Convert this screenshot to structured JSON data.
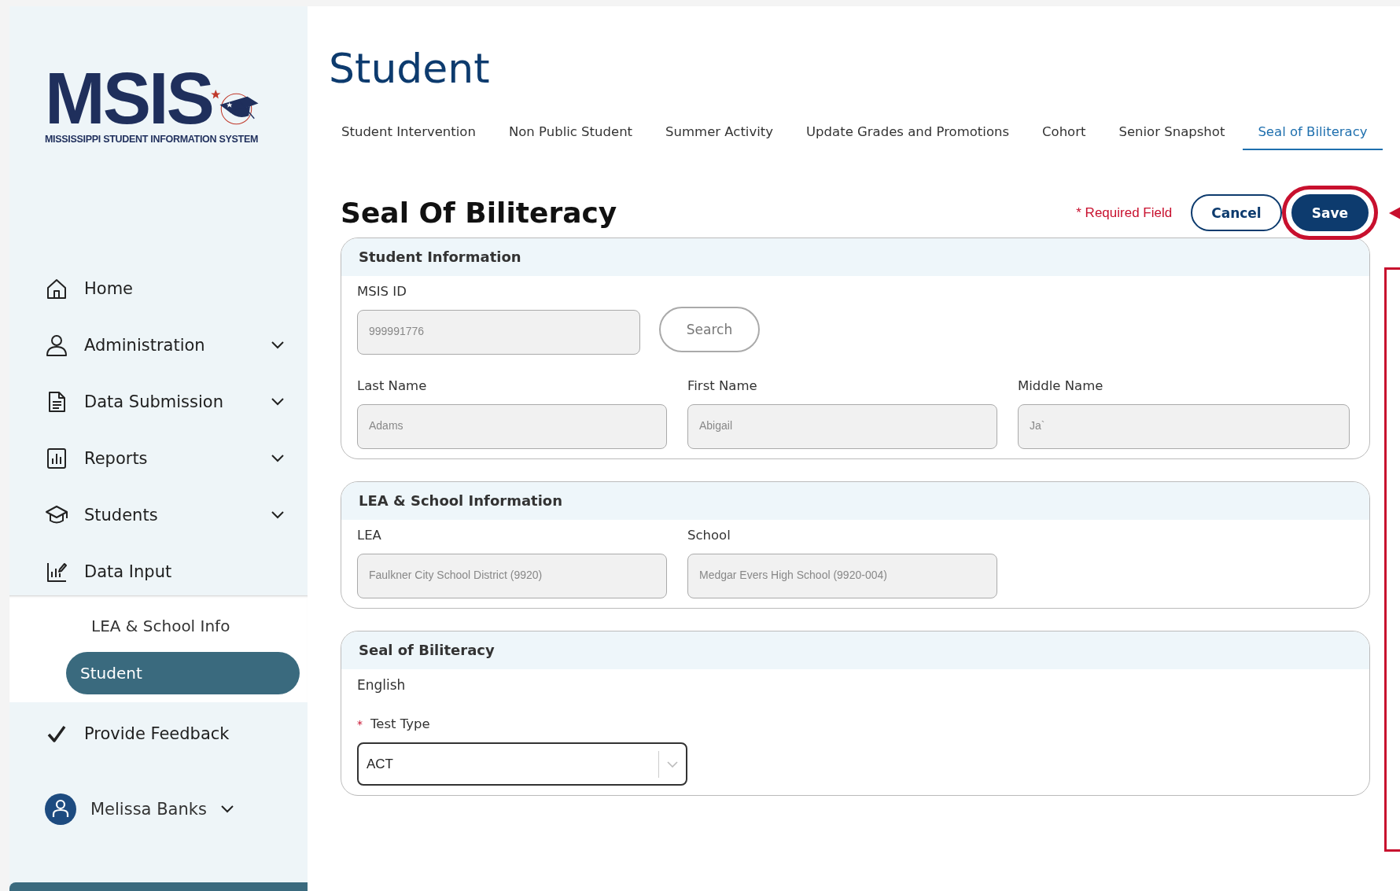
{
  "logo": {
    "wordmark": "MSIS",
    "tagline": "MISSISSIPPI STUDENT INFORMATION SYSTEM"
  },
  "sidebar": {
    "items": [
      {
        "label": "Home",
        "kind": "home",
        "expandable": false
      },
      {
        "label": "Administration",
        "kind": "person",
        "expandable": true
      },
      {
        "label": "Data Submission",
        "kind": "document",
        "expandable": true
      },
      {
        "label": "Reports",
        "kind": "report",
        "expandable": true
      },
      {
        "label": "Students",
        "kind": "cap",
        "expandable": true
      },
      {
        "label": "Data Input",
        "kind": "input",
        "expandable": false,
        "children": [
          {
            "label": "LEA & School Info",
            "selected": false
          },
          {
            "label": "Student",
            "selected": true
          }
        ]
      },
      {
        "label": "Provide Feedback",
        "kind": "check",
        "expandable": false
      }
    ],
    "user": {
      "name": "Melissa Banks"
    }
  },
  "page_title": "Student",
  "tabs": [
    {
      "label": "Student Intervention",
      "selected": false
    },
    {
      "label": "Non Public Student",
      "selected": false
    },
    {
      "label": "Summer Activity",
      "selected": false
    },
    {
      "label": "Update Grades and Promotions",
      "selected": false
    },
    {
      "label": "Cohort",
      "selected": false
    },
    {
      "label": "Senior Snapshot",
      "selected": false
    },
    {
      "label": "Seal of Biliteracy",
      "selected": true
    }
  ],
  "form": {
    "title": "Seal Of Biliteracy",
    "required_note": "* Required Field",
    "buttons": [
      {
        "label": "Cancel",
        "kind": "outline",
        "highlighted": false
      },
      {
        "label": "Save",
        "kind": "primary",
        "highlighted": true
      }
    ],
    "annotation_frame": true,
    "sections": [
      {
        "title": "Student Information",
        "rows": [
          [
            {
              "kind": "input",
              "label": "MSIS ID",
              "value": "999991776",
              "disabled": true
            },
            {
              "kind": "button",
              "label": "Search"
            }
          ],
          [
            {
              "kind": "input",
              "label": "Last Name",
              "value": "Adams",
              "disabled": true
            },
            {
              "kind": "input",
              "label": "First Name",
              "value": "Abigail",
              "disabled": true
            },
            {
              "kind": "input",
              "label": "Middle Name",
              "value": "Ja`",
              "disabled": true
            }
          ]
        ]
      },
      {
        "title": "LEA & School Information",
        "rows": [
          [
            {
              "kind": "input",
              "label": "LEA",
              "value": "Faulkner City School District (9920)",
              "disabled": true
            },
            {
              "kind": "input",
              "label": "School",
              "value": "Medgar Evers High School (9920-004)",
              "disabled": true
            }
          ]
        ]
      },
      {
        "title": "Seal of Biliteracy",
        "rows": [
          [
            {
              "kind": "text",
              "label": "English"
            }
          ],
          [
            {
              "kind": "select",
              "label": "Test Type",
              "value": "ACT",
              "required_mark": "*",
              "disabled": false
            }
          ]
        ]
      }
    ]
  }
}
